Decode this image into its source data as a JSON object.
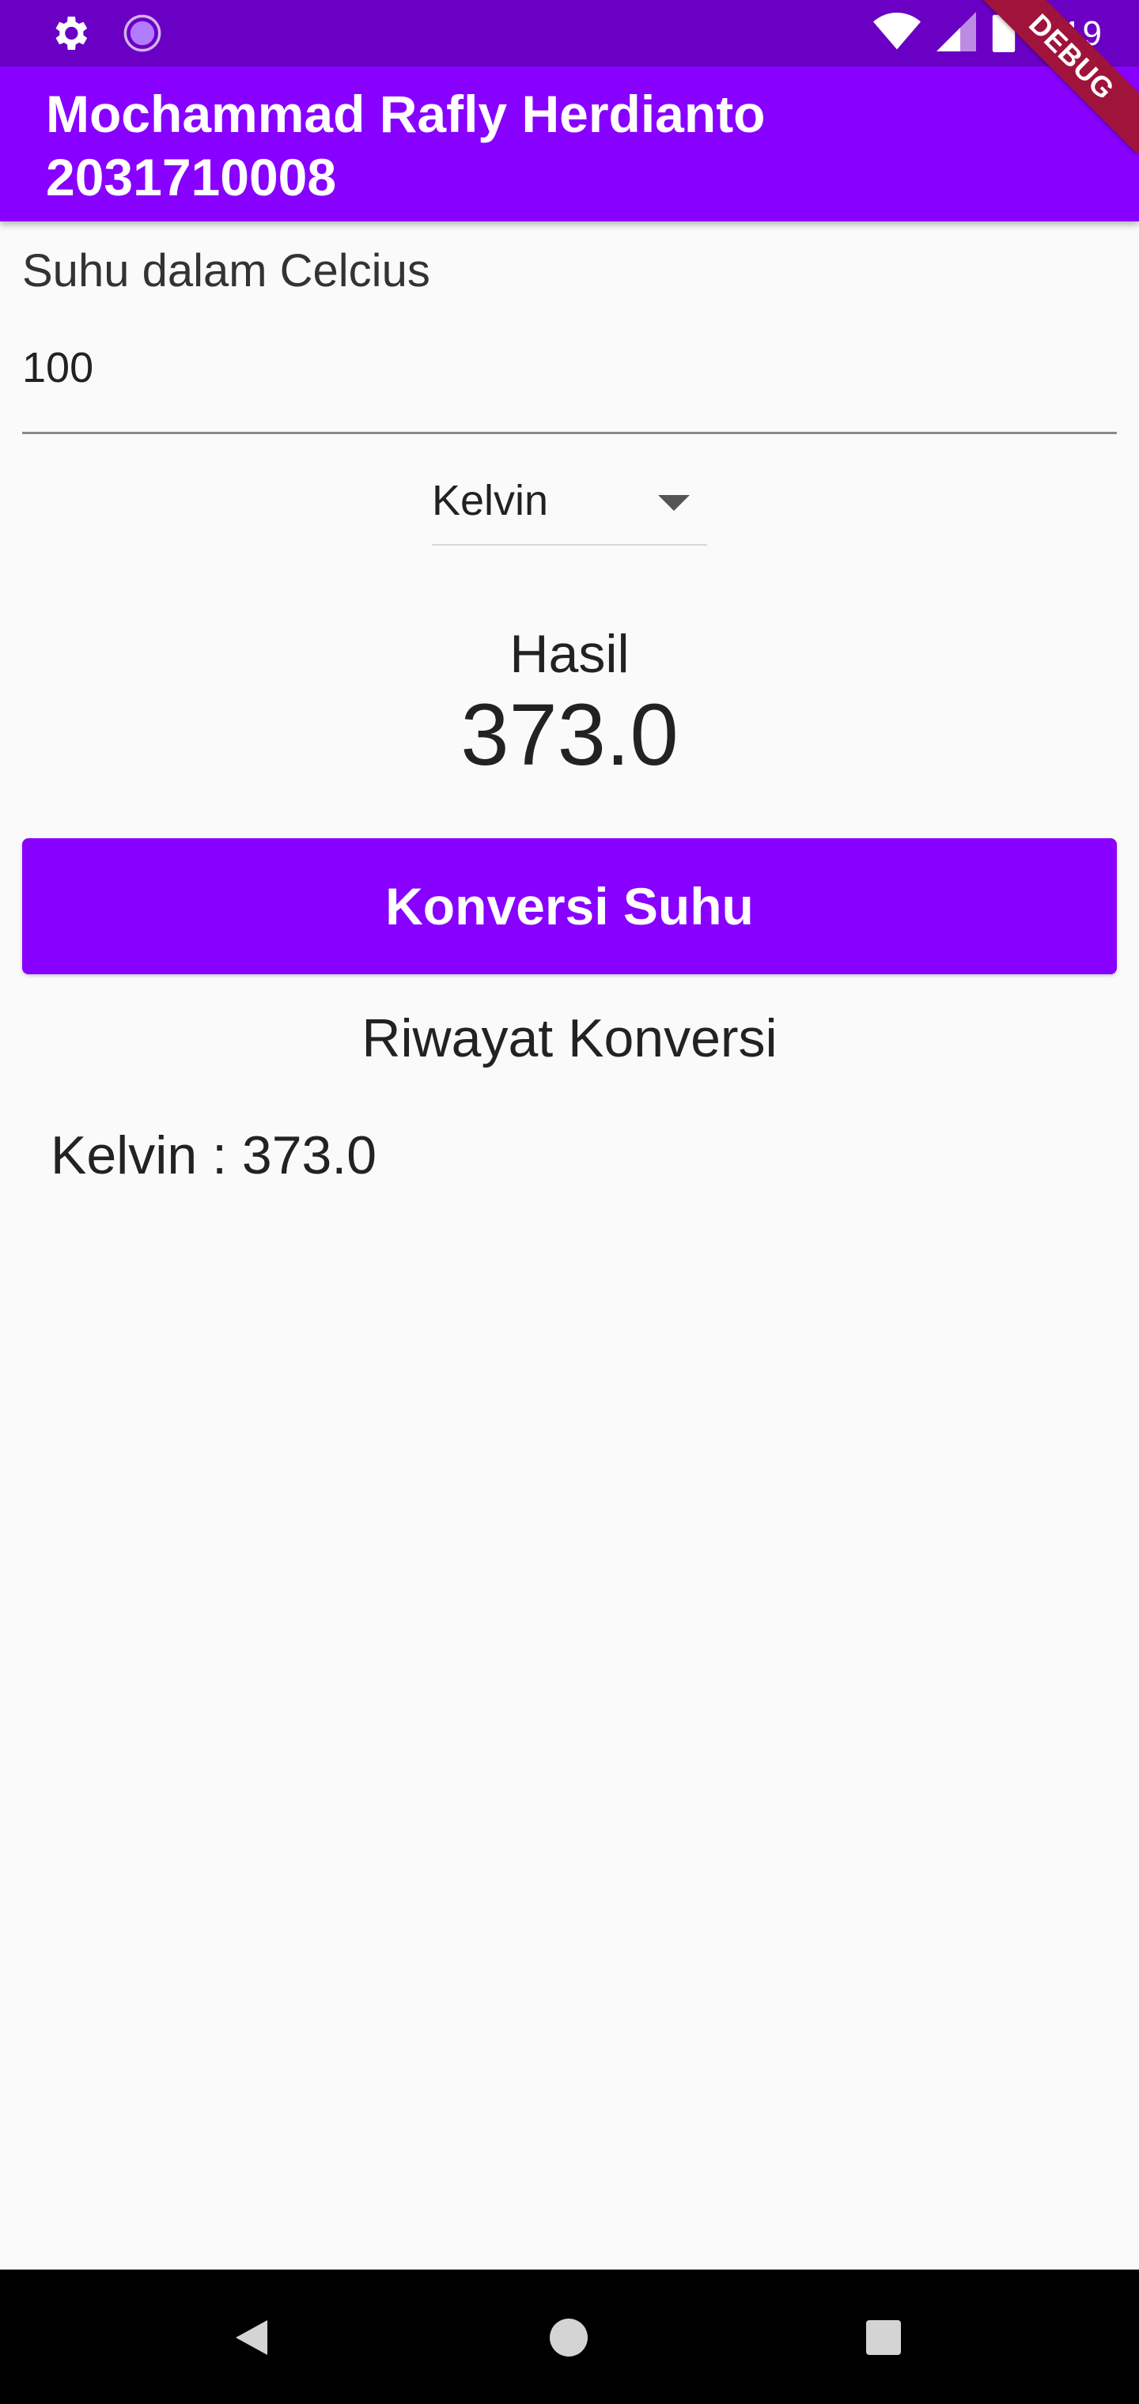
{
  "status_bar": {
    "time": "3:19",
    "icons": [
      "gear-icon",
      "progress-circle-icon",
      "wifi-icon",
      "cell-signal-icon",
      "battery-icon"
    ]
  },
  "debug_banner": "DEBUG",
  "app_bar": {
    "title_line1": "Mochammad Rafly Herdianto",
    "title_line2": "2031710008"
  },
  "form": {
    "input_label": "Suhu dalam Celcius",
    "input_value": "100",
    "dropdown_selected": "Kelvin"
  },
  "result": {
    "label": "Hasil",
    "value": "373.0"
  },
  "convert_button_label": "Konversi Suhu",
  "history": {
    "title": "Riwayat Konversi",
    "items": [
      "Kelvin : 373.0"
    ]
  },
  "nav_bar": {
    "buttons": [
      "back-icon",
      "home-icon",
      "recents-icon"
    ]
  },
  "colors": {
    "primary": "#8800ff",
    "status_bar": "#6a00c4",
    "debug": "#a0133b"
  }
}
